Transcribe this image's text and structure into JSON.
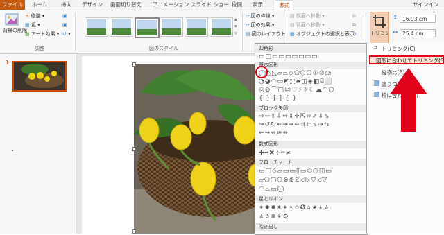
{
  "tabs": {
    "file": "ファイル",
    "home": "ホーム",
    "insert": "挿入",
    "design": "デザイン",
    "transitions": "画面切り替え",
    "animations": "アニメーション",
    "slideshow": "スライド ショー",
    "review": "校閲",
    "view": "表示",
    "format": "書式",
    "signin": "サインイン"
  },
  "ribbon": {
    "adjust": {
      "remove_bg": "背景の削除",
      "corrections": "修整",
      "color": "色",
      "artistic": "アート効果",
      "group_label": "調整"
    },
    "styles": {
      "group_label": "図のスタイル"
    },
    "picture": {
      "border": "図の枠線",
      "effects": "図の効果",
      "layout": "図のレイアウト"
    },
    "arrange": {
      "bring_forward": "前面へ移動",
      "send_backward": "背面へ移動",
      "selection_pane": "オブジェクトの選択と表示"
    },
    "size": {
      "crop": "トリミング",
      "height": "16.93 cm",
      "width": "25.4 cm"
    }
  },
  "slide_pane": {
    "slide_number": "1"
  },
  "shapes_gallery": {
    "categories": [
      "四角形",
      "基本図形",
      "ブロック矢印",
      "数式図形",
      "フローチャート",
      "星とリボン",
      "吹き出し"
    ],
    "rows": {
      "rect": "▭▢▭▭▭▭▭▭▭",
      "basic1": "◯△◺▱⏢◇⬠⬡⎔⑦⑩⑫",
      "basic2": "◔◕◠▭◤⬚▰◫◈◧⌸⬜",
      "basic3": "◎⊘⌒▢☺♡⚡☼☾☁◠⬡",
      "basic4": "{ } [ ] { }",
      "arrows1": "⇨⇦⇧⇩⇔⇕✛⇱⬄⇗⇓⇘",
      "arrows2": "↪↺↻⇤⇥⇛⇚⇉⇇↘⇢⇆",
      "arrows3": "⇜⇝⇏⇎⇻",
      "math": "✚━✖÷═≠",
      "flow1": "▭▢◇▱▭▭▯▭⬭○◫▭",
      "flow2": "▱⬠▢⬡⊗⊕⧖◁▷▽◁▽",
      "flow3": "◠⌓▭◯",
      "stars1": "✴✹✸✷✦✧✩✪✫✬✭✮",
      "stars2": "✯✰❋⚘⚙"
    }
  },
  "crop_menu": {
    "items": [
      "トリミング(C)",
      "図形に合わせてトリミング(S)",
      "縦横比(A)",
      "塗りつぶし(L)",
      "枠に合わせる(I)"
    ]
  },
  "colors": {
    "accent": "#c55a11",
    "highlight": "#e1001a",
    "slide_border": "#d04a02"
  }
}
